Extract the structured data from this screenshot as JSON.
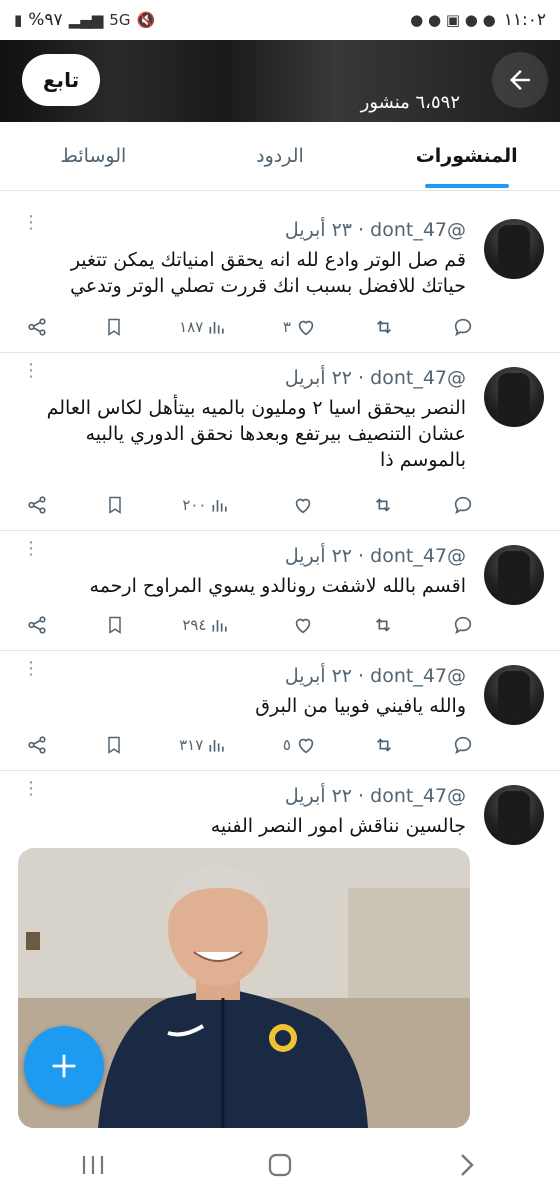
{
  "status_bar": {
    "time": "١١:٠٢",
    "battery": "%٩٧",
    "network": "5G"
  },
  "header": {
    "follow_label": "تابع",
    "posts_count": "٦،٥٩٢ منشور"
  },
  "tabs": [
    {
      "label": "المنشورات",
      "active": true
    },
    {
      "label": "الردود",
      "active": false
    },
    {
      "label": "الوسائط",
      "active": false
    }
  ],
  "tweets": [
    {
      "handle": "@dont_47",
      "date": "٢٣ أبريل",
      "text": "قم صل الوتر وادع لله انه يحقق امنياتك يمكن تتغير حياتك للافضل بسبب انك قررت تصلي الوتر وتدعي",
      "likes": "٣",
      "views": "١٨٧",
      "retweets": "",
      "replies": ""
    },
    {
      "handle": "@dont_47",
      "date": "٢٢ أبريل",
      "text": "النصر بيحقق اسيا ٢ ومليون بالميه بيتأهل لكاس العالم عشان التنصيف بيرتفع وبعدها نحقق الدوري يالبيه بالموسم ذا",
      "likes": "",
      "views": "٢٠٠",
      "retweets": "",
      "replies": ""
    },
    {
      "handle": "@dont_47",
      "date": "٢٢ أبريل",
      "text": "اقسم بالله لاشفت رونالدو يسوي المراوح ارحمه",
      "likes": "",
      "views": "٢٩٤",
      "retweets": "",
      "replies": ""
    },
    {
      "handle": "@dont_47",
      "date": "٢٢ أبريل",
      "text": "والله يافيني فوبيا من البرق",
      "likes": "٥",
      "views": "٣١٧",
      "retweets": "",
      "replies": ""
    },
    {
      "handle": "@dont_47",
      "date": "٢٢ أبريل",
      "text": "جالسين نناقش امور النصر الفنيه"
    }
  ],
  "colors": {
    "accent": "#1d9bf0",
    "text": "#0f1419",
    "muted": "#536471"
  },
  "icons": {
    "back": "arrow-left-icon",
    "more": "more-vertical-icon",
    "reply": "reply-icon",
    "retweet": "retweet-icon",
    "like": "heart-icon",
    "views": "views-icon",
    "bookmark": "bookmark-icon",
    "share": "share-icon",
    "compose": "plus-icon"
  }
}
